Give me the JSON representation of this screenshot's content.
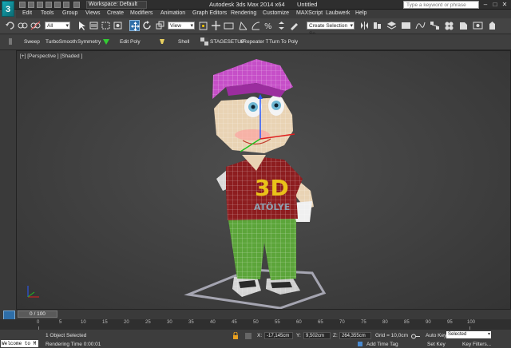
{
  "titlebar": {
    "logo": "3",
    "workspace": "Workspace: Default",
    "app_title": "Autodesk 3ds Max 2014 x64",
    "file_title": "Untitled",
    "search_placeholder": "Type a keyword or phrase",
    "min": "–",
    "max": "□",
    "close": "✕"
  },
  "menu": [
    "Edit",
    "Tools",
    "Group",
    "Views",
    "Create",
    "Modifiers",
    "Animation",
    "Graph Editors",
    "Rendering",
    "Customize",
    "MAXScript",
    "Laubwerk",
    "Help"
  ],
  "toolbar": {
    "filter_value": "All",
    "view_value": "View",
    "selection_set_placeholder": "Create Selection Se"
  },
  "modifier_bar": {
    "items": [
      "Sweep",
      "TurboSmooth",
      "Symmetry",
      "Edit Poly",
      "Shell",
      "STAGESETUP",
      "sRepeater T",
      "Turn To Poly"
    ]
  },
  "viewport": {
    "label": "[+] [Perspective ] [Shaded ]",
    "shirt_text_1": "3D",
    "shirt_text_2": "ATÖLYE"
  },
  "timeline": {
    "frame_display": "0 / 100",
    "ticks": [
      "0",
      "5",
      "10",
      "15",
      "20",
      "25",
      "30",
      "35",
      "40",
      "45",
      "50",
      "55",
      "60",
      "65",
      "70",
      "75",
      "80",
      "85",
      "90",
      "95",
      "100"
    ]
  },
  "status": {
    "listener_text": "Welcome to M",
    "selection_info": "1 Object Selected",
    "render_time": "Rendering Time  0:00:01",
    "x_label": "X:",
    "x_value": "-17,145cm",
    "y_label": "Y:",
    "y_value": "9,502cm",
    "z_label": "Z:",
    "z_value": "264,355cm",
    "grid": "Grid = 10,0cm",
    "add_time_tag": "Add Time Tag",
    "auto_key": "Auto Key",
    "set_key": "Set Key",
    "selected_option": "Selected",
    "key_filters": "Key Filters..."
  },
  "colors": {
    "logo_teal": "#17a9b6",
    "cap_magenta": "#c64fc8",
    "shirt_red": "#8d1d1f",
    "shirt_text_yellow": "#e9c21a",
    "pants_green": "#5ca53a",
    "skin": "#e9d3b4",
    "wire_white": "#ffffff",
    "accent_blue": "#2e6ea8"
  }
}
